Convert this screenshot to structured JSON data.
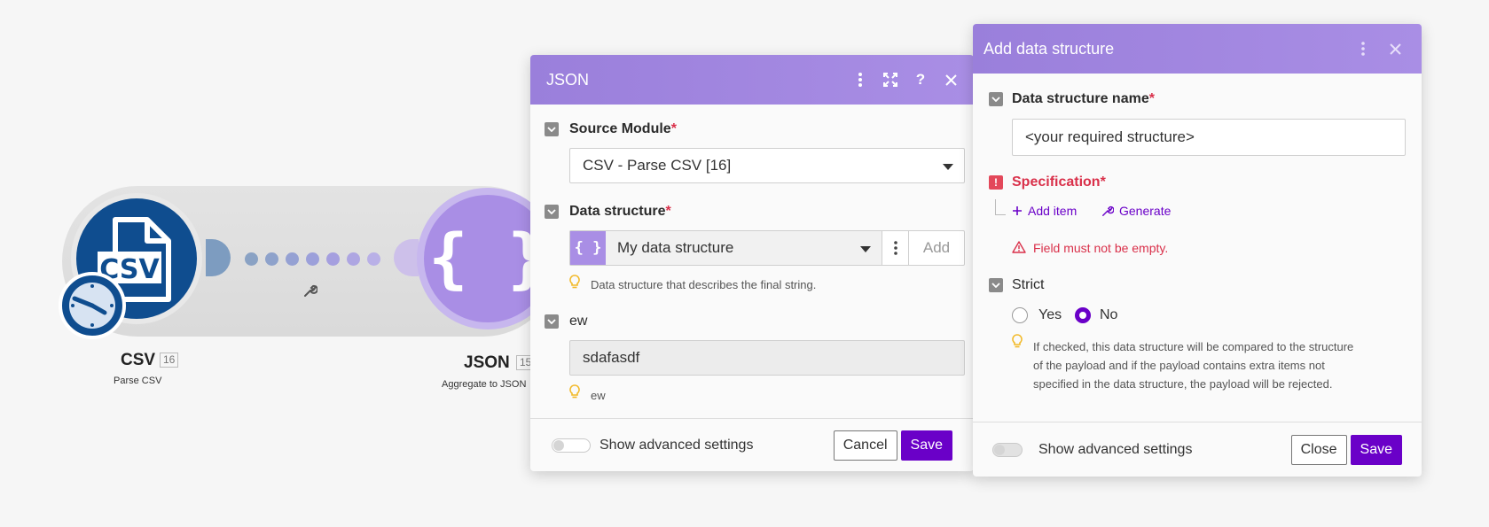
{
  "scenario": {
    "csv_module": {
      "label": "CSV",
      "badge": "16",
      "sublabel": "Parse CSV",
      "icon_text": "CSV"
    },
    "json_module": {
      "label": "JSON",
      "badge": "15",
      "sublabel": "Aggregate to JSON",
      "icon_text": "{ }"
    }
  },
  "json_panel": {
    "title": "JSON",
    "source_module": {
      "label": "Source Module",
      "required": "*",
      "value": "CSV - Parse CSV [16]"
    },
    "data_structure": {
      "label": "Data structure",
      "required": "*",
      "icon_text": "{ }",
      "value": "My data structure",
      "add_label": "Add",
      "hint": "Data structure that describes the final string."
    },
    "ew": {
      "label": "ew",
      "value": "sdafasdf",
      "hint": "ew"
    },
    "footer": {
      "advanced": "Show advanced settings",
      "cancel": "Cancel",
      "save": "Save"
    }
  },
  "add_panel": {
    "title": "Add data structure",
    "name_field": {
      "label": "Data structure name",
      "required": "*",
      "value": "<your required structure>"
    },
    "specification": {
      "label": "Specification",
      "required": "*",
      "error_badge": "!",
      "add_item": "Add item",
      "generate": "Generate",
      "error": "Field must not be empty."
    },
    "strict": {
      "label": "Strict",
      "yes": "Yes",
      "no": "No",
      "selected": "No",
      "hint_lines": [
        "If checked, this data structure will be compared to the structure",
        "of the payload and if the payload contains extra items not",
        "specified in the data structure, the payload will be rejected."
      ]
    },
    "footer": {
      "advanced": "Show advanced settings",
      "close": "Close",
      "save": "Save"
    }
  },
  "colors": {
    "accent": "#6a00c8",
    "header": "#a98ee5",
    "csv_blue": "#0f4d8f",
    "error": "#d9304a"
  }
}
